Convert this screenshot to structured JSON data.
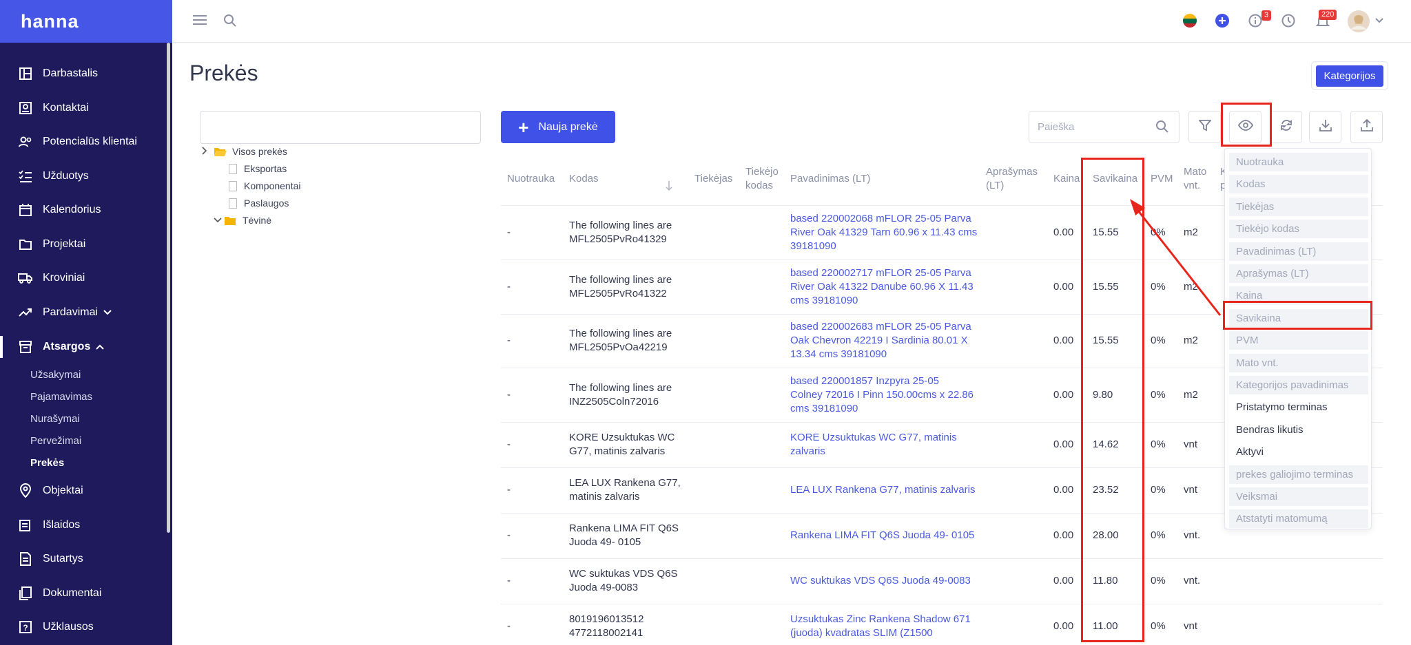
{
  "app": {
    "brand": "hanna"
  },
  "sidebar": {
    "items": [
      {
        "label": "Darbastalis",
        "icon": "dashboard-icon"
      },
      {
        "label": "Kontaktai",
        "icon": "contacts-icon"
      },
      {
        "label": "Potencialūs klientai",
        "icon": "leads-icon"
      },
      {
        "label": "Užduotys",
        "icon": "tasks-icon"
      },
      {
        "label": "Kalendorius",
        "icon": "calendar-icon"
      },
      {
        "label": "Projektai",
        "icon": "folder-icon"
      },
      {
        "label": "Kroviniai",
        "icon": "truck-icon"
      },
      {
        "label": "Pardavimai",
        "icon": "trend-icon"
      },
      {
        "label": "Atsargos",
        "icon": "archive-icon"
      },
      {
        "label": "Objektai",
        "icon": "location-pin-icon"
      },
      {
        "label": "Išlaidos",
        "icon": "expenses-icon"
      },
      {
        "label": "Sutartys",
        "icon": "contract-icon"
      },
      {
        "label": "Dokumentai",
        "icon": "documents-icon"
      },
      {
        "label": "Užklausos",
        "icon": "question-icon"
      }
    ],
    "subitems": [
      "Užsakymai",
      "Pajamavimas",
      "Nurašymai",
      "Pervežimai",
      "Prekės"
    ]
  },
  "topbar": {
    "info_badge": "3",
    "notifications_badge": "220"
  },
  "page": {
    "title": "Prekės",
    "categories_button": "Kategorijos",
    "new_button": "Nauja prekė",
    "search_placeholder": "Paieška"
  },
  "tree": {
    "root": "Visos prekės",
    "children": [
      "Eksportas",
      "Komponentai",
      "Paslaugos"
    ],
    "parent": "Tėvinė"
  },
  "table": {
    "headers": {
      "photo": "Nuotrauka",
      "code": "Kodas",
      "supplier": "Tiekėjas",
      "supplier_code_1": "Tiekėjo",
      "supplier_code_2": "kodas",
      "name": "Pavadinimas (LT)",
      "desc_1": "Aprašymas",
      "desc_2": "(LT)",
      "price": "Kaina",
      "cost": "Savikaina",
      "vat": "PVM",
      "unit_1": "Mato",
      "unit_2": "vnt.",
      "cut_1": "K",
      "cut_2": "p"
    },
    "rows": [
      {
        "photo": "-",
        "code": [
          "The following lines are",
          "MFL2505PvRo41329"
        ],
        "name": [
          "based 220002068 mFLOR 25-05 Parva",
          "River Oak 41329 Tarn 60.96 x 11.43 cms",
          "39181090"
        ],
        "price": "0.00",
        "cost": "15.55",
        "vat": "0%",
        "unit": "m2"
      },
      {
        "photo": "-",
        "code": [
          "The following lines are",
          "MFL2505PvRo41322"
        ],
        "name": [
          "based 220002717 mFLOR 25-05 Parva",
          "River Oak 41322 Danube 60.96 X 11.43",
          "cms 39181090"
        ],
        "price": "0.00",
        "cost": "15.55",
        "vat": "0%",
        "unit": "m2"
      },
      {
        "photo": "-",
        "code": [
          "The following lines are",
          "MFL2505PvOa42219"
        ],
        "name": [
          "based 220002683 mFLOR 25-05 Parva",
          "Oak Chevron 42219 I Sardinia 80.01 X",
          "13.34 cms 39181090"
        ],
        "price": "0.00",
        "cost": "15.55",
        "vat": "0%",
        "unit": "m2"
      },
      {
        "photo": "-",
        "code": [
          "The following lines are",
          "INZ2505Coln72016"
        ],
        "name": [
          "based 220001857 Inzpyra 25-05",
          "Colney 72016 I Pinn 150.00cms x 22.86",
          "cms 39181090"
        ],
        "price": "0.00",
        "cost": "9.80",
        "vat": "0%",
        "unit": "m2"
      },
      {
        "photo": "-",
        "code": [
          "KORE Uzsuktukas WC",
          "G77, matinis zalvaris"
        ],
        "name": [
          "KORE Uzsuktukas WC G77, matinis",
          "zalvaris"
        ],
        "price": "0.00",
        "cost": "14.62",
        "vat": "0%",
        "unit": "vnt"
      },
      {
        "photo": "-",
        "code": [
          "LEA LUX Rankena G77,",
          "matinis zalvaris"
        ],
        "name": [
          "LEA LUX Rankena G77, matinis zalvaris"
        ],
        "price": "0.00",
        "cost": "23.52",
        "vat": "0%",
        "unit": "vnt"
      },
      {
        "photo": "-",
        "code": [
          "Rankena LIMA FIT Q6S",
          "Juoda 49- 0105"
        ],
        "name": [
          "Rankena LIMA FIT Q6S Juoda 49- 0105"
        ],
        "price": "0.00",
        "cost": "28.00",
        "vat": "0%",
        "unit": "vnt."
      },
      {
        "photo": "-",
        "code": [
          "WC suktukas VDS Q6S",
          "Juoda 49-0083"
        ],
        "name": [
          "WC suktukas VDS Q6S Juoda 49-0083"
        ],
        "price": "0.00",
        "cost": "11.80",
        "vat": "0%",
        "unit": "vnt."
      },
      {
        "photo": "-",
        "code": [
          "8019196013512",
          "4772118002141"
        ],
        "name": [
          "Uzsuktukas Zinc Rankena Shadow 671",
          "(juoda) kvadratas SLIM (Z1500"
        ],
        "price": "0.00",
        "cost": "11.00",
        "vat": "0%",
        "unit": "vnt"
      }
    ]
  },
  "column_menu": [
    {
      "label": "Nuotrauka",
      "visible": false
    },
    {
      "label": "Kodas",
      "visible": false
    },
    {
      "label": "Tiekėjas",
      "visible": false
    },
    {
      "label": "Tiekėjo kodas",
      "visible": false
    },
    {
      "label": "Pavadinimas (LT)",
      "visible": false
    },
    {
      "label": "Aprašymas (LT)",
      "visible": false
    },
    {
      "label": "Kaina",
      "visible": false
    },
    {
      "label": "Savikaina",
      "visible": false
    },
    {
      "label": "PVM",
      "visible": false
    },
    {
      "label": "Mato vnt.",
      "visible": false
    },
    {
      "label": "Kategorijos pavadinimas",
      "visible": false
    },
    {
      "label": "Pristatymo terminas",
      "visible": true
    },
    {
      "label": "Bendras likutis",
      "visible": true
    },
    {
      "label": "Aktyvi",
      "visible": true
    },
    {
      "label": "prekes galiojimo terminas",
      "visible": false
    },
    {
      "label": "Veiksmai",
      "visible": false
    },
    {
      "label": "Atstatyti matomumą",
      "visible": false
    }
  ],
  "colors": {
    "sidebar_bg": "#1e1a5c",
    "accent": "#3f51e6",
    "highlight": "#e8251c"
  }
}
